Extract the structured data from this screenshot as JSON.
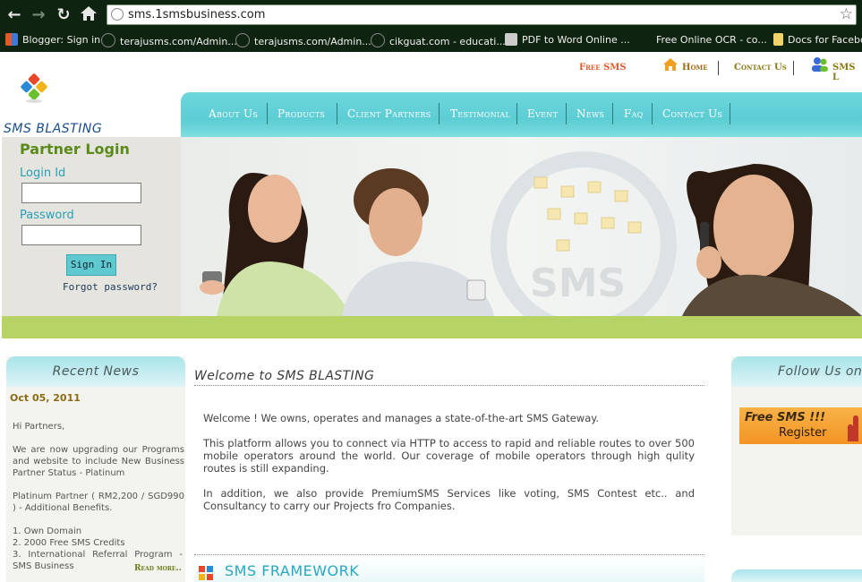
{
  "browser": {
    "url": "sms.1smsbusiness.com",
    "bookmarks": [
      {
        "label": "Blogger: Sign in",
        "color": "#e35a2a"
      },
      {
        "label": "terajusms.com/Admin...",
        "color": "#333333"
      },
      {
        "label": "terajusms.com/Admin...",
        "color": "#333333"
      },
      {
        "label": "cikguat.com - educati...",
        "color": "#333333"
      },
      {
        "label": "PDF to Word Online ...",
        "color": "#cccccc"
      },
      {
        "label": "Free Online OCR - co...",
        "color": "#0f2410"
      },
      {
        "label": "Docs for Facebo",
        "color": "#f2d36a"
      }
    ]
  },
  "header": {
    "free_sms": "Free SMS",
    "home": "Home",
    "contact": "Contact Us",
    "sms_login": "SMS L",
    "brand": "SMS BLASTING"
  },
  "menu": [
    "About Us",
    "Products",
    "Client Partners",
    "Testimonial",
    "Event",
    "News",
    "Faq",
    "Contact Us"
  ],
  "login": {
    "title": "Partner Login",
    "login_label": "Login Id",
    "password_label": "Password",
    "signin": "Sign In",
    "forgot": "Forgot password?"
  },
  "hero": {
    "watermark": "SMS"
  },
  "news": {
    "title": "Recent News",
    "date": "Oct 05, 2011",
    "paragraphs": [
      "Hi Partners,",
      "We are now upgrading our Programs and website to include New Business Partner Status - Platinum",
      "Platinum Partner ( RM2,200 / SGD990 ) - Additional Benefits."
    ],
    "list": [
      "1. Own Domain",
      "2. 2000 Free SMS Credits",
      "3. International Referral Program - SMS Business"
    ],
    "read_more": "Read more.."
  },
  "main": {
    "title": "Welcome to SMS BLASTING",
    "paragraphs": [
      "Welcome ! We owns, operates and manages a state-of-the-art SMS Gateway.",
      "This platform allows you to connect via HTTP to access to rapid and reliable routes to over 500 mobile operators around the world. Our coverage of mobile operators through high qulity routes is still expanding.",
      "In addition, we also provide PremiumSMS Services like voting, SMS Contest etc.. and Consultancy to carry our Projects fro Companies."
    ],
    "framework_title": "SMS FRAMEWORK"
  },
  "right": {
    "follow_title": "Follow Us on",
    "free_sms": "Free SMS !!!",
    "register": "Register"
  }
}
